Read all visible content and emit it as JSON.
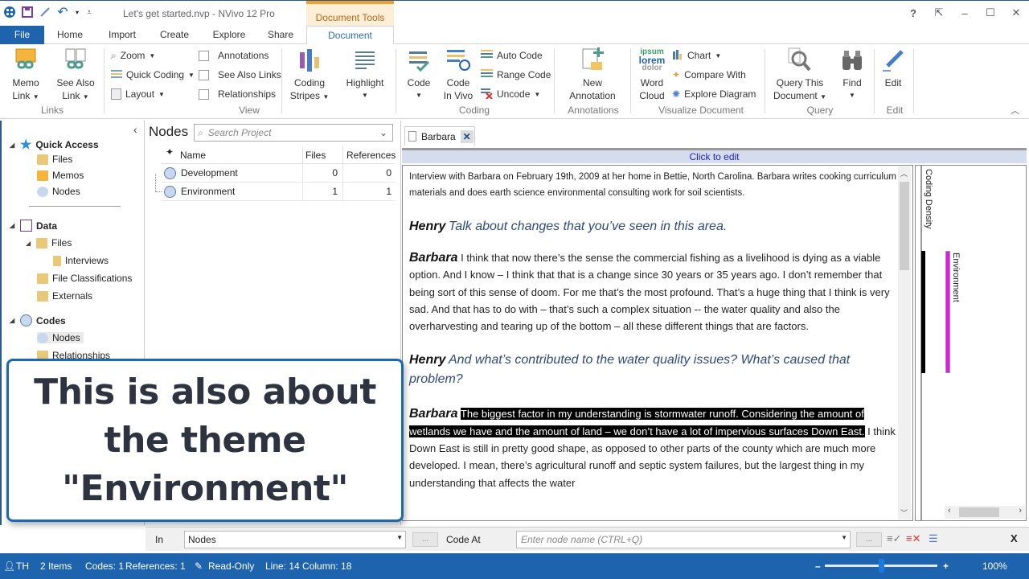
{
  "window": {
    "title": "Let's get started.nvp - NVivo 12 Pro",
    "context_tab_group": "Document Tools",
    "controls": {
      "help": "?",
      "restore_ribbon": "⇱",
      "minimize": "–",
      "maximize": "☐",
      "close": "✕"
    }
  },
  "quick_access": {
    "icons": [
      "nvivo-logo-icon",
      "save-icon",
      "edit-icon",
      "undo-icon",
      "undo-dropdown-icon",
      "customize-icon"
    ]
  },
  "tabs": [
    {
      "label": "File"
    },
    {
      "label": "Home"
    },
    {
      "label": "Import"
    },
    {
      "label": "Create"
    },
    {
      "label": "Explore"
    },
    {
      "label": "Share"
    },
    {
      "label": "Document",
      "active": true
    }
  ],
  "ribbon": {
    "groups": {
      "links": "Links",
      "view": "View",
      "coding": "Coding",
      "annotations": "Annotations",
      "visualize": "Visualize Document",
      "query": "Query",
      "edit": "Edit"
    },
    "memo_link": {
      "line1": "Memo",
      "line2": "Link"
    },
    "see_also_link": {
      "line1": "See Also",
      "line2": "Link"
    },
    "zoom": "Zoom",
    "quick_coding": "Quick Coding",
    "layout": "Layout",
    "annotations": {
      "label": "Annotations",
      "checked": false
    },
    "see_also_links": {
      "label": "See Also Links",
      "checked": false
    },
    "relationships": {
      "label": "Relationships",
      "checked": false
    },
    "coding_stripes": {
      "line1": "Coding",
      "line2": "Stripes"
    },
    "highlight": "Highlight",
    "code": "Code",
    "code_in_vivo": {
      "line1": "Code",
      "line2": "In Vivo"
    },
    "auto_code": "Auto Code",
    "range_code": "Range Code",
    "uncode": "Uncode",
    "new_annotation": {
      "line1": "New",
      "line2": "Annotation"
    },
    "word_cloud": {
      "line1": "Word",
      "line2": "Cloud",
      "icon_text": [
        "ipsum",
        "lorem",
        "dolor"
      ]
    },
    "chart": "Chart",
    "compare_with": "Compare With",
    "explore_diagram": "Explore Diagram",
    "query_this_document": {
      "line1": "Query This",
      "line2": "Document"
    },
    "find": "Find",
    "edit": "Edit"
  },
  "nav": {
    "quick_access": {
      "label": "Quick Access",
      "items": [
        "Files",
        "Memos",
        "Nodes"
      ]
    },
    "data": {
      "label": "Data",
      "files": "Files",
      "interviews": "Interviews",
      "file_classifications": "File Classifications",
      "externals": "Externals"
    },
    "codes": {
      "label": "Codes",
      "nodes": "Nodes",
      "relationships": "Relationships"
    },
    "collapse": "‹"
  },
  "nodes_pane": {
    "title": "Nodes",
    "search_placeholder": "Search Project",
    "columns": {
      "name": "Name",
      "files": "Files",
      "references": "References"
    },
    "rows": [
      {
        "name": "Development",
        "files": "0",
        "references": "0"
      },
      {
        "name": "Environment",
        "files": "1",
        "references": "1"
      }
    ]
  },
  "document": {
    "tab_label": "Barbara",
    "click_to_edit": "Click to edit",
    "intro": "Interview with Barbara on February 19th, 2009 at her home in Bettie, North Carolina. Barbara writes cooking curriculum materials and does earth science environmental consulting work for soil scientists.",
    "paragraphs": [
      {
        "speaker": "Henry",
        "text": "Talk about changes that you’ve seen in this area.",
        "question": true
      },
      {
        "speaker": "Barbara",
        "text": "I think that now there’s the sense the commercial fishing as a livelihood is dying as a viable option. And I know – I think that that is a change since 30 years or 35 years ago. I don’t remember that being sort of this sense of doom. For me that’s the most profound. That’s a huge thing that I think is very sad. And that has to do with – that’s such a complex situation -- the water quality and also the overharvesting and tearing up of the bottom – all these different things that are factors.",
        "question": false
      },
      {
        "speaker": "Henry",
        "text": "And what’s contributed to the water quality issues? What’s caused that problem?",
        "question": true
      },
      {
        "speaker": "Barbara",
        "selected_text": "The biggest factor in my understanding is stormwater runoff. Considering the amount of wetlands we have and the amount of land – we don’t have a lot of impervious surfaces Down East.",
        "text": " I think Down East is still in pretty good shape, as opposed to other parts of the county which are much more developed. I mean, there’s agricultural runoff and septic system failures, but the largest thing in my understanding that affects the water",
        "question": false
      }
    ]
  },
  "coding_stripes": {
    "density_label": "Coding Density",
    "stripes": [
      {
        "label": "Environment",
        "color": "#ee11ee"
      }
    ],
    "density_color": "#000000"
  },
  "callout": {
    "text": "This is also about the theme \"Environment\""
  },
  "coding_bar": {
    "in_label": "In",
    "in_value": "Nodes",
    "browse": "...",
    "code_at_label": "Code At",
    "code_at_placeholder": "Enter node name (CTRL+Q)",
    "close": "X"
  },
  "status": {
    "user": "TH",
    "items": "2 Items",
    "codes": "Codes: 1",
    "references": "References: 1",
    "read_only": "Read-Only",
    "position": "Line: 14 Column: 18",
    "zoom_percent": "100%",
    "zoom_minus": "–",
    "zoom_plus": "+",
    "zoom_level": 0.5
  },
  "colors": {
    "accent": "#1e63ad",
    "context_tab": "#fdeed8",
    "context_tab_text": "#b36a12",
    "question_text": "#2c4a7a",
    "click_to_edit_text": "#2323b0"
  }
}
